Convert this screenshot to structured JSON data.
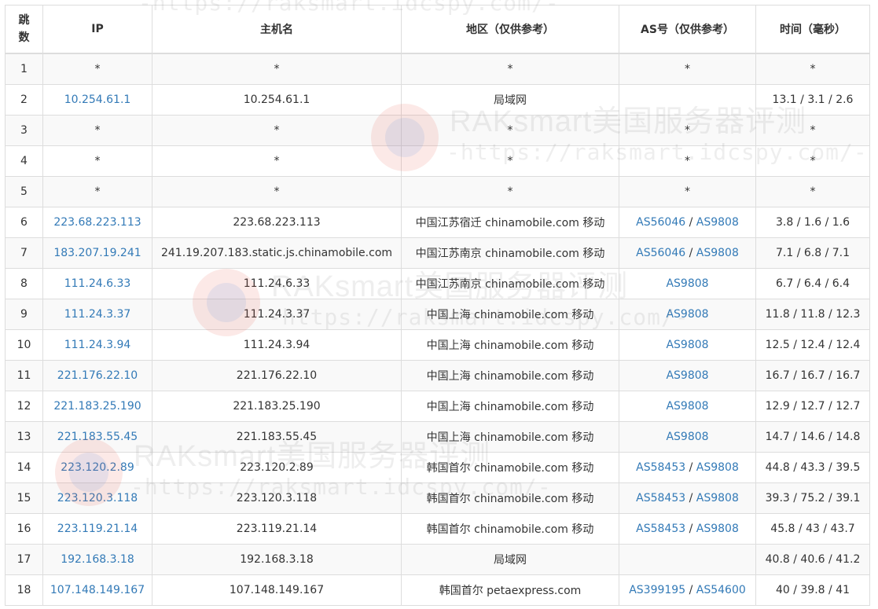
{
  "table": {
    "headers": {
      "hop_line1": "跳",
      "hop_line2": "数",
      "ip": "IP",
      "hostname": "主机名",
      "region": "地区（仅供参考）",
      "as": "AS号（仅供参考）",
      "time": "时间（毫秒）"
    },
    "rows": [
      {
        "hop": "1",
        "ip": "*",
        "host": "*",
        "region": "*",
        "as1": "*",
        "as2": "",
        "time": "*"
      },
      {
        "hop": "2",
        "ip": "10.254.61.1",
        "host": "10.254.61.1",
        "region": "局域网",
        "as1": "",
        "as2": "",
        "time": "13.1 / 3.1 / 2.6"
      },
      {
        "hop": "3",
        "ip": "*",
        "host": "*",
        "region": "*",
        "as1": "*",
        "as2": "",
        "time": "*"
      },
      {
        "hop": "4",
        "ip": "*",
        "host": "*",
        "region": "*",
        "as1": "*",
        "as2": "",
        "time": "*"
      },
      {
        "hop": "5",
        "ip": "*",
        "host": "*",
        "region": "*",
        "as1": "*",
        "as2": "",
        "time": "*"
      },
      {
        "hop": "6",
        "ip": "223.68.223.113",
        "host": "223.68.223.113",
        "region": "中国江苏宿迁 chinamobile.com 移动",
        "as1": "AS56046",
        "as2": "AS9808",
        "time": "3.8 / 1.6 / 1.6"
      },
      {
        "hop": "7",
        "ip": "183.207.19.241",
        "host": "241.19.207.183.static.js.chinamobile.com",
        "region": "中国江苏南京 chinamobile.com 移动",
        "as1": "AS56046",
        "as2": "AS9808",
        "time": "7.1 / 6.8 / 7.1"
      },
      {
        "hop": "8",
        "ip": "111.24.6.33",
        "host": "111.24.6.33",
        "region": "中国江苏南京 chinamobile.com 移动",
        "as1": "AS9808",
        "as2": "",
        "time": "6.7 / 6.4 / 6.4"
      },
      {
        "hop": "9",
        "ip": "111.24.3.37",
        "host": "111.24.3.37",
        "region": "中国上海 chinamobile.com 移动",
        "as1": "AS9808",
        "as2": "",
        "time": "11.8 / 11.8 / 12.3"
      },
      {
        "hop": "10",
        "ip": "111.24.3.94",
        "host": "111.24.3.94",
        "region": "中国上海 chinamobile.com 移动",
        "as1": "AS9808",
        "as2": "",
        "time": "12.5 / 12.4 / 12.4"
      },
      {
        "hop": "11",
        "ip": "221.176.22.10",
        "host": "221.176.22.10",
        "region": "中国上海 chinamobile.com 移动",
        "as1": "AS9808",
        "as2": "",
        "time": "16.7 / 16.7 / 16.7"
      },
      {
        "hop": "12",
        "ip": "221.183.25.190",
        "host": "221.183.25.190",
        "region": "中国上海 chinamobile.com 移动",
        "as1": "AS9808",
        "as2": "",
        "time": "12.9 / 12.7 / 12.7"
      },
      {
        "hop": "13",
        "ip": "221.183.55.45",
        "host": "221.183.55.45",
        "region": "中国上海 chinamobile.com 移动",
        "as1": "AS9808",
        "as2": "",
        "time": "14.7 / 14.6 / 14.8"
      },
      {
        "hop": "14",
        "ip": "223.120.2.89",
        "host": "223.120.2.89",
        "region": "韩国首尔 chinamobile.com 移动",
        "as1": "AS58453",
        "as2": "AS9808",
        "time": "44.8 / 43.3 / 39.5"
      },
      {
        "hop": "15",
        "ip": "223.120.3.118",
        "host": "223.120.3.118",
        "region": "韩国首尔 chinamobile.com 移动",
        "as1": "AS58453",
        "as2": "AS9808",
        "time": "39.3 / 75.2 / 39.1"
      },
      {
        "hop": "16",
        "ip": "223.119.21.14",
        "host": "223.119.21.14",
        "region": "韩国首尔 chinamobile.com 移动",
        "as1": "AS58453",
        "as2": "AS9808",
        "time": "45.8 / 43 / 43.7"
      },
      {
        "hop": "17",
        "ip": "192.168.3.18",
        "host": "192.168.3.18",
        "region": "局域网",
        "as1": "",
        "as2": "",
        "time": "40.8 / 40.6 / 41.2"
      },
      {
        "hop": "18",
        "ip": "107.148.149.167",
        "host": "107.148.149.167",
        "region": "韩国首尔 petaexpress.com",
        "as1": "AS399195",
        "as2": "AS54600",
        "time": "40 / 39.8 / 41"
      }
    ]
  },
  "watermark": {
    "title": "RAKsmart美国服务器评测",
    "url": "-https://raksmart.idcspy.com/-"
  },
  "colors": {
    "link": "#337ab7",
    "border": "#dddddd",
    "stripe": "#f9f9f9",
    "text": "#333333"
  }
}
